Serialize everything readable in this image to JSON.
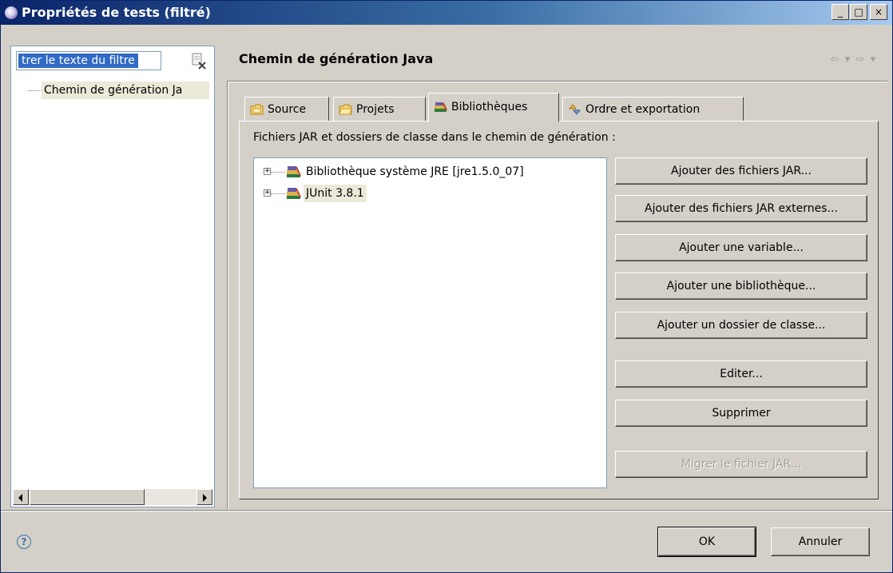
{
  "window": {
    "title": "Propriétés de tests (filtré)"
  },
  "caption": {
    "minimize": "_",
    "maximize": "□",
    "close": "×"
  },
  "left": {
    "filter_value": "trer le texte du filtre",
    "tree_item": "Chemin de génération Ja"
  },
  "page": {
    "title": "Chemin de génération Java"
  },
  "tabs": [
    {
      "label": "Source",
      "icon": "source-folder-icon"
    },
    {
      "label": "Projets",
      "icon": "project-folder-icon"
    },
    {
      "label": "Bibliothèques",
      "icon": "library-icon",
      "active": true
    },
    {
      "label": "Ordre et exportation",
      "icon": "order-export-icon"
    }
  ],
  "libraries": {
    "label": "Fichiers JAR et dossiers de classe dans le chemin de génération :",
    "items": [
      {
        "label": "Bibliothèque système JRE [jre1.5.0_07]"
      },
      {
        "label": "JUnit 3.8.1"
      }
    ]
  },
  "buttons": {
    "add_jars": "Ajouter des fichiers JAR...",
    "add_external_jars": "Ajouter des fichiers JAR externes...",
    "add_variable": "Ajouter une variable...",
    "add_library": "Ajouter une bibliothèque...",
    "add_class_folder": "Ajouter un dossier de classe...",
    "edit": "Editer...",
    "remove": "Supprimer",
    "migrate_jar": "Migrer le fichier JAR..."
  },
  "dialog": {
    "ok": "OK",
    "cancel": "Annuler",
    "help": "?"
  }
}
